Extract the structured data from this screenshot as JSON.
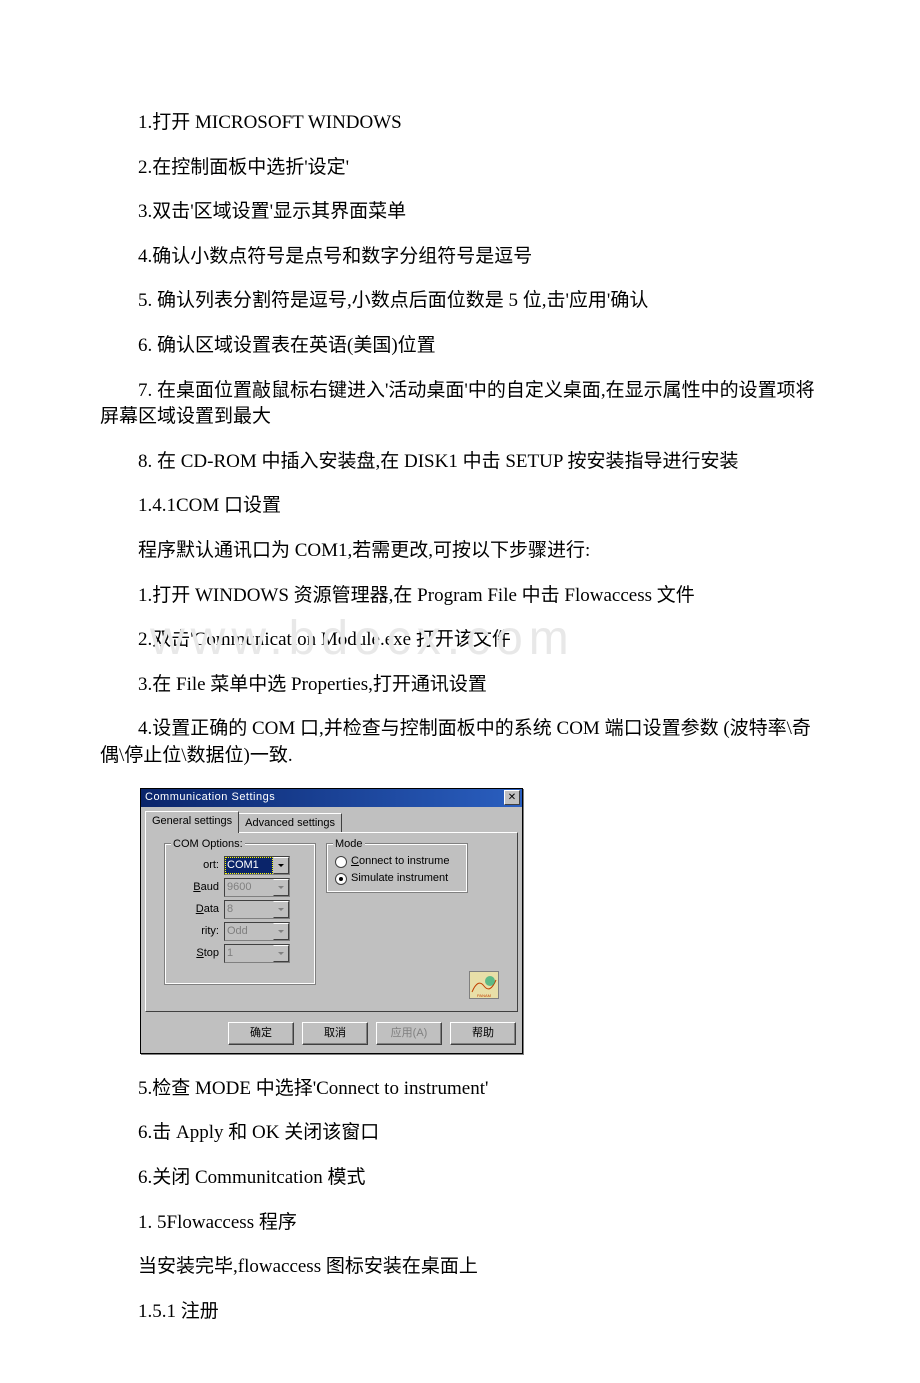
{
  "lines": {
    "l1": "1.打开 MICROSOFT WINDOWS",
    "l2": "2.在控制面板中选折'设定'",
    "l3": "3.双击'区域设置'显示其界面菜单",
    "l4": "4.确认小数点符号是点号和数字分组符号是逗号",
    "l5": "5. 确认列表分割符是逗号,小数点后面位数是 5 位,击'应用'确认",
    "l6": "6. 确认区域设置表在英语(美国)位置",
    "l7": "7. 在桌面位置敲鼠标右键进入'活动桌面'中的自定义桌面,在显示属性中的设置项将屏幕区域设置到最大",
    "l8": "8. 在 CD-ROM 中插入安装盘,在 DISK1 中击 SETUP 按安装指导进行安装",
    "l9": "1.4.1COM 口设置",
    "l10": "程序默认通讯口为 COM1,若需更改,可按以下步骤进行:",
    "l11": "1.打开 WINDOWS 资源管理器,在 Program File 中击 Flowaccess 文件",
    "l12": "2.双击'Communication Module.exe 打开该文件",
    "l13": "3.在 File 菜单中选 Properties,打开通讯设置",
    "l14": "4.设置正确的 COM 口,并检查与控制面板中的系统 COM 端口设置参数 (波特率\\奇偶\\停止位\\数据位)一致.",
    "l15": "5.检查 MODE 中选择'Connect to instrument'",
    "l16": "6.击 Apply 和 OK 关闭该窗口",
    "l17": "6.关闭 Communitcation 模式",
    "l18": "1. 5Flowaccess 程序",
    "l19": "当安装完毕,flowaccess 图标安装在桌面上",
    "l20": "1.5.1 注册"
  },
  "watermark": "www.bdocx.com",
  "dialog": {
    "title": "Communication Settings",
    "tabs": {
      "general": "General settings",
      "advanced": "Advanced settings"
    },
    "groups": {
      "com": "COM Options:",
      "mode": "Mode"
    },
    "fields": {
      "port_label": "ort:",
      "port_value": "COM1",
      "baud_label": "Baud",
      "baud_value": "9600",
      "data_label": "Data",
      "data_value": "8",
      "parity_label": "rity:",
      "parity_value": "Odd",
      "stop_label": "Stop",
      "stop_value": "1"
    },
    "mode": {
      "opt1": "Connect to instrume",
      "opt2": "Simulate instrument"
    },
    "buttons": {
      "ok": "确定",
      "cancel": "取消",
      "apply": "应用(A)",
      "help": "帮助"
    }
  }
}
